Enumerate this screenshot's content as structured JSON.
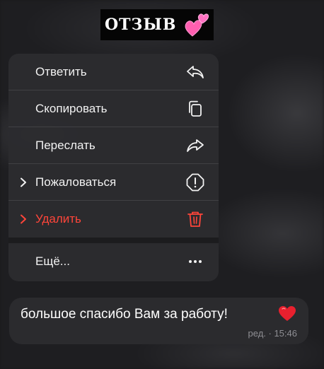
{
  "sticker": {
    "text": "ОТЗЫВ"
  },
  "menu": {
    "items": [
      {
        "label": "Ответить",
        "icon": "reply-icon",
        "chevron": false,
        "danger": false
      },
      {
        "label": "Скопировать",
        "icon": "copy-icon",
        "chevron": false,
        "danger": false
      },
      {
        "label": "Переслать",
        "icon": "forward-icon",
        "chevron": false,
        "danger": false
      },
      {
        "label": "Пожаловаться",
        "icon": "report-icon",
        "chevron": true,
        "danger": false
      },
      {
        "label": "Удалить",
        "icon": "trash-icon",
        "chevron": true,
        "danger": true
      },
      {
        "label": "Ещё...",
        "icon": "more-icon",
        "chevron": false,
        "danger": false
      }
    ],
    "danger_color": "#ff453a"
  },
  "message": {
    "text": "большое спасибо Вам за работу!",
    "meta": "ред. · 15:46",
    "emoji": "heart-icon"
  }
}
